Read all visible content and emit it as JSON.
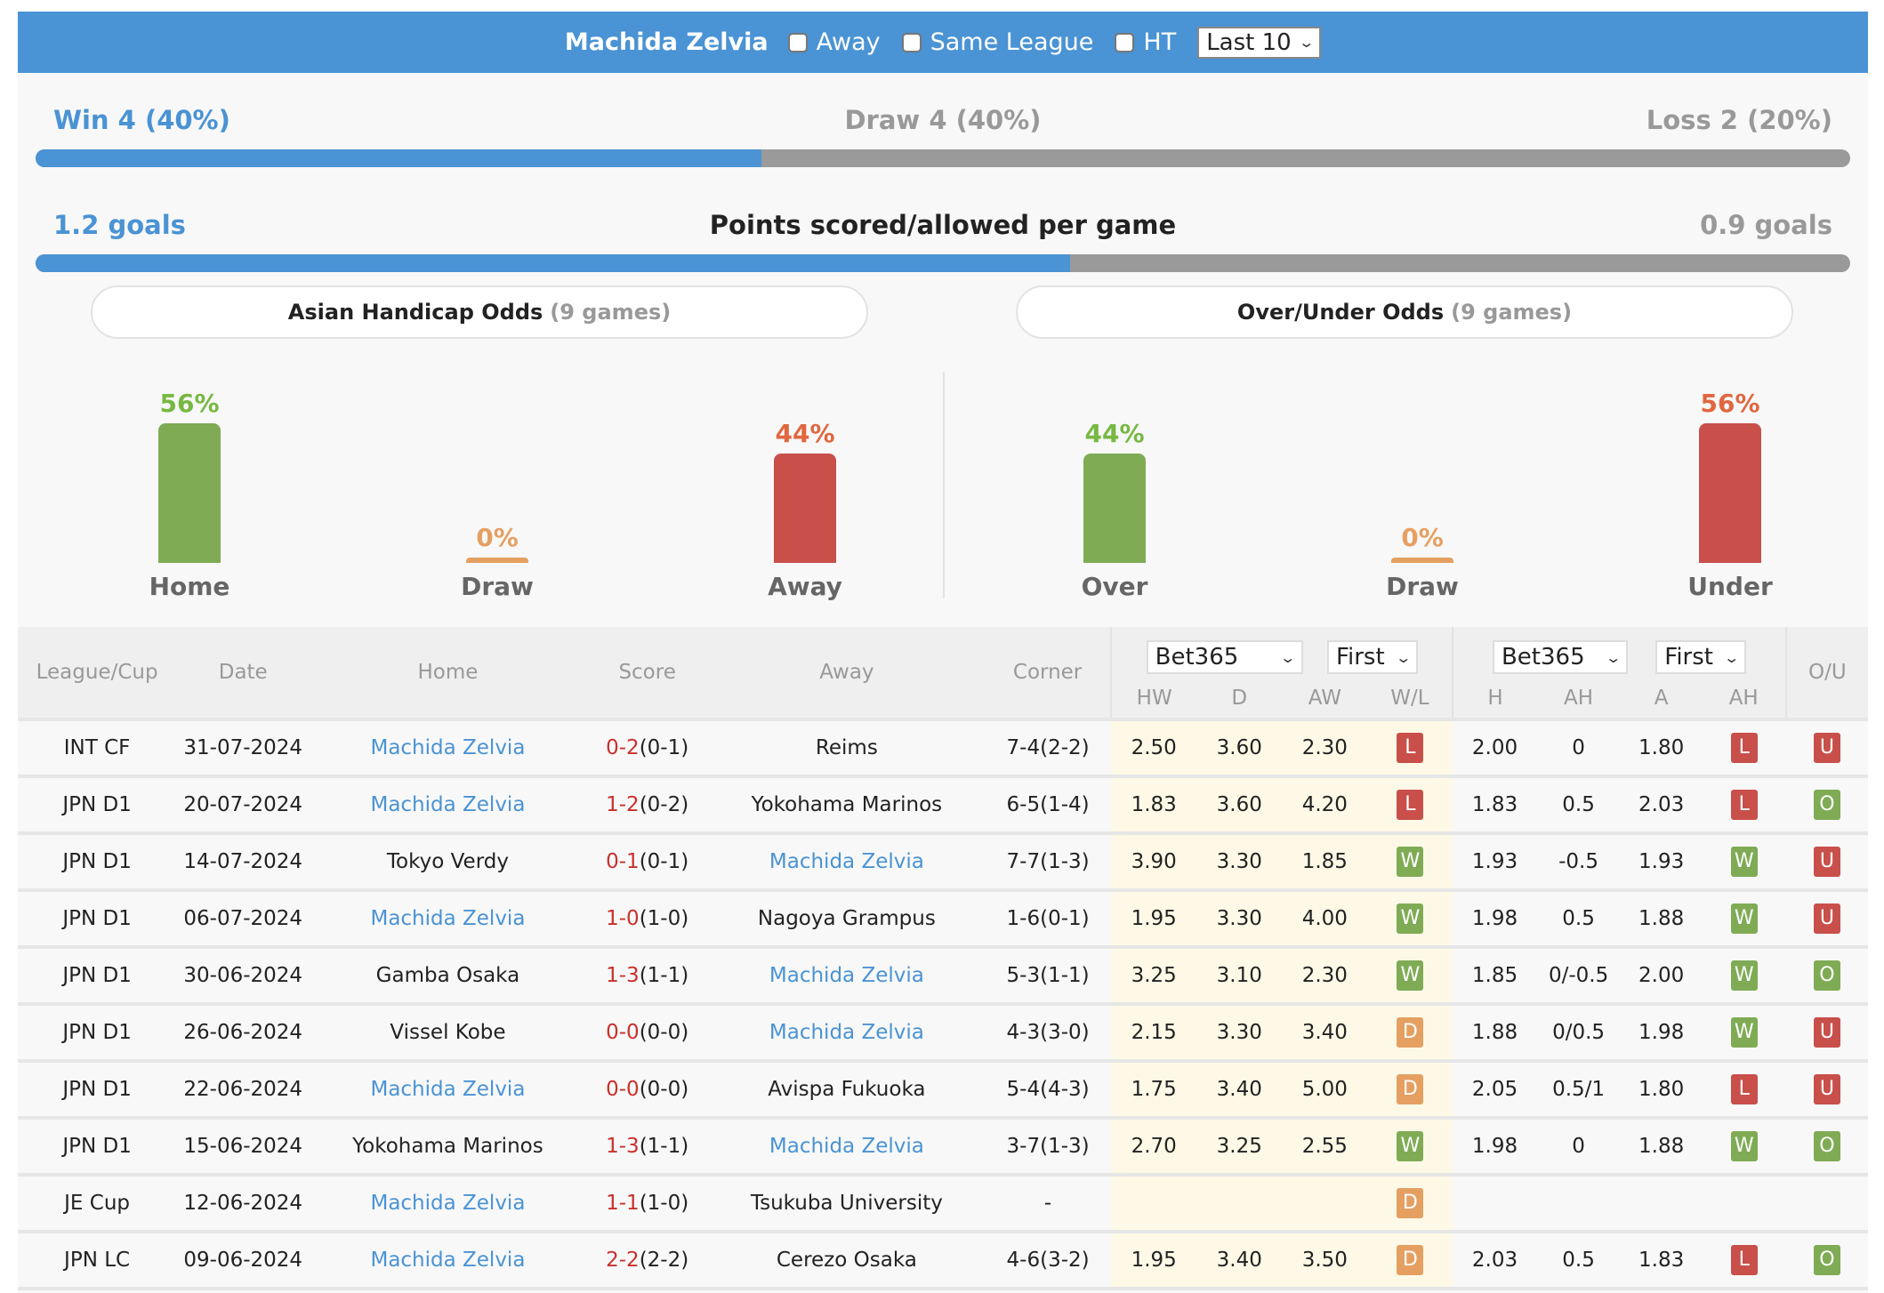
{
  "topbar": {
    "team": "Machida Zelvia",
    "filters": [
      {
        "label": "Away",
        "checked": false
      },
      {
        "label": "Same League",
        "checked": false
      },
      {
        "label": "HT",
        "checked": false
      }
    ],
    "range_select": "Last 10"
  },
  "record": {
    "win": "Win 4 (40%)",
    "draw": "Draw 4 (40%)",
    "loss": "Loss 2 (20%)",
    "win_fraction": 0.4
  },
  "goals": {
    "scored": "1.2 goals",
    "title": "Points scored/allowed per game",
    "allowed": "0.9 goals",
    "scored_fraction": 0.57
  },
  "asian_handicap": {
    "title": "Asian Handicap Odds",
    "count": "(9 games)",
    "items": [
      {
        "label": "Home",
        "pct": "56%",
        "value": 56,
        "color": "#7fab55",
        "text_color": "#77b843"
      },
      {
        "label": "Draw",
        "pct": "0%",
        "value": 0,
        "color": "#e5a061",
        "text_color": "#e5a061"
      },
      {
        "label": "Away",
        "pct": "44%",
        "value": 44,
        "color": "#c84f4a",
        "text_color": "#e0673f"
      }
    ]
  },
  "over_under": {
    "title": "Over/Under Odds",
    "count": "(9 games)",
    "items": [
      {
        "label": "Over",
        "pct": "44%",
        "value": 44,
        "color": "#7fab55",
        "text_color": "#77b843"
      },
      {
        "label": "Draw",
        "pct": "0%",
        "value": 0,
        "color": "#e5a061",
        "text_color": "#e5a061"
      },
      {
        "label": "Under",
        "pct": "56%",
        "value": 56,
        "color": "#c84f4a",
        "text_color": "#e0673f"
      }
    ]
  },
  "table": {
    "headers": {
      "league": "League/Cup",
      "date": "Date",
      "home": "Home",
      "score": "Score",
      "away": "Away",
      "corner": "Corner",
      "odds1_company": "Bet365",
      "odds1_type": "First",
      "odds2_company": "Bet365",
      "odds2_type": "First",
      "hw": "HW",
      "d": "D",
      "aw": "AW",
      "wl": "W/L",
      "h": "H",
      "ah": "AH",
      "a": "A",
      "ah2": "AH",
      "ou": "O/U"
    },
    "rows": [
      {
        "league": "INT CF",
        "date": "31-07-2024",
        "home": "Machida Zelvia",
        "home_link": true,
        "ft": "0-2",
        "ht": "(0-1)",
        "away": "Reims",
        "away_link": false,
        "corner": "7-4(2-2)",
        "hw": "2.50",
        "d": "3.60",
        "aw": "2.30",
        "wl": "L",
        "h": "2.00",
        "ah": "0",
        "a": "1.80",
        "ahr": "L",
        "ou": "U"
      },
      {
        "league": "JPN D1",
        "date": "20-07-2024",
        "home": "Machida Zelvia",
        "home_link": true,
        "ft": "1-2",
        "ht": "(0-2)",
        "away": "Yokohama Marinos",
        "away_link": false,
        "corner": "6-5(1-4)",
        "hw": "1.83",
        "d": "3.60",
        "aw": "4.20",
        "wl": "L",
        "h": "1.83",
        "ah": "0.5",
        "a": "2.03",
        "ahr": "L",
        "ou": "O"
      },
      {
        "league": "JPN D1",
        "date": "14-07-2024",
        "home": "Tokyo Verdy",
        "home_link": false,
        "ft": "0-1",
        "ht": "(0-1)",
        "away": "Machida Zelvia",
        "away_link": true,
        "corner": "7-7(1-3)",
        "hw": "3.90",
        "d": "3.30",
        "aw": "1.85",
        "wl": "W",
        "h": "1.93",
        "ah": "-0.5",
        "a": "1.93",
        "ahr": "W",
        "ou": "U"
      },
      {
        "league": "JPN D1",
        "date": "06-07-2024",
        "home": "Machida Zelvia",
        "home_link": true,
        "ft": "1-0",
        "ht": "(1-0)",
        "away": "Nagoya Grampus",
        "away_link": false,
        "corner": "1-6(0-1)",
        "hw": "1.95",
        "d": "3.30",
        "aw": "4.00",
        "wl": "W",
        "h": "1.98",
        "ah": "0.5",
        "a": "1.88",
        "ahr": "W",
        "ou": "U"
      },
      {
        "league": "JPN D1",
        "date": "30-06-2024",
        "home": "Gamba Osaka",
        "home_link": false,
        "ft": "1-3",
        "ht": "(1-1)",
        "away": "Machida Zelvia",
        "away_link": true,
        "corner": "5-3(1-1)",
        "hw": "3.25",
        "d": "3.10",
        "aw": "2.30",
        "wl": "W",
        "h": "1.85",
        "ah": "0/-0.5",
        "a": "2.00",
        "ahr": "W",
        "ou": "O"
      },
      {
        "league": "JPN D1",
        "date": "26-06-2024",
        "home": "Vissel Kobe",
        "home_link": false,
        "ft": "0-0",
        "ht": "(0-0)",
        "away": "Machida Zelvia",
        "away_link": true,
        "corner": "4-3(3-0)",
        "hw": "2.15",
        "d": "3.30",
        "aw": "3.40",
        "wl": "D",
        "h": "1.88",
        "ah": "0/0.5",
        "a": "1.98",
        "ahr": "W",
        "ou": "U"
      },
      {
        "league": "JPN D1",
        "date": "22-06-2024",
        "home": "Machida Zelvia",
        "home_link": true,
        "ft": "0-0",
        "ht": "(0-0)",
        "away": "Avispa Fukuoka",
        "away_link": false,
        "corner": "5-4(4-3)",
        "hw": "1.75",
        "d": "3.40",
        "aw": "5.00",
        "wl": "D",
        "h": "2.05",
        "ah": "0.5/1",
        "a": "1.80",
        "ahr": "L",
        "ou": "U"
      },
      {
        "league": "JPN D1",
        "date": "15-06-2024",
        "home": "Yokohama Marinos",
        "home_link": false,
        "ft": "1-3",
        "ht": "(1-1)",
        "away": "Machida Zelvia",
        "away_link": true,
        "corner": "3-7(1-3)",
        "hw": "2.70",
        "d": "3.25",
        "aw": "2.55",
        "wl": "W",
        "h": "1.98",
        "ah": "0",
        "a": "1.88",
        "ahr": "W",
        "ou": "O"
      },
      {
        "league": "JE Cup",
        "date": "12-06-2024",
        "home": "Machida Zelvia",
        "home_link": true,
        "ft": "1-1",
        "ht": "(1-0)",
        "away": "Tsukuba University",
        "away_link": false,
        "corner": "-",
        "hw": "",
        "d": "",
        "aw": "",
        "wl": "D",
        "h": "",
        "ah": "",
        "a": "",
        "ahr": "",
        "ou": ""
      },
      {
        "league": "JPN LC",
        "date": "09-06-2024",
        "home": "Machida Zelvia",
        "home_link": true,
        "ft": "2-2",
        "ht": "(2-2)",
        "away": "Cerezo Osaka",
        "away_link": false,
        "corner": "4-6(3-2)",
        "hw": "1.95",
        "d": "3.40",
        "aw": "3.50",
        "wl": "D",
        "h": "2.03",
        "ah": "0.5",
        "a": "1.83",
        "ahr": "L",
        "ou": "O"
      }
    ]
  }
}
